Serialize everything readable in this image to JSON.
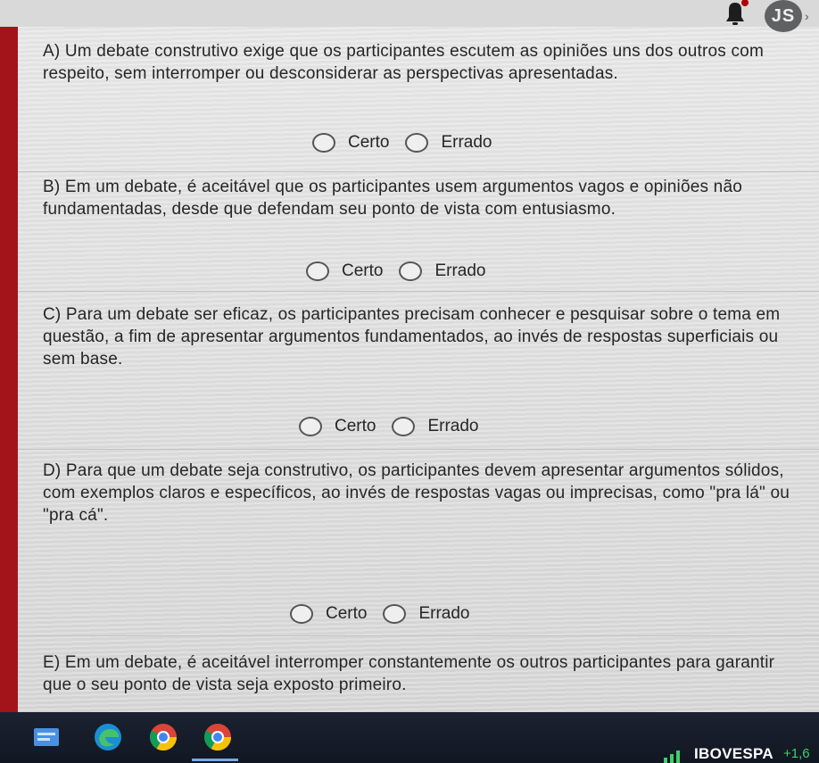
{
  "user": {
    "initials": "JS"
  },
  "questions": [
    {
      "text": "A) Um debate construtivo exige que os participantes escutem as opiniões uns dos outros com respeito, sem interromper ou desconsiderar as perspectivas apresentadas.",
      "options": [
        "Certo",
        "Errado"
      ]
    },
    {
      "text": "B)  Em um debate, é aceitável que os participantes usem argumentos vagos e opiniões não fundamentadas, desde que defendam seu ponto de vista com entusiasmo.",
      "options": [
        "Certo",
        "Errado"
      ]
    },
    {
      "text": "C) Para um debate ser eficaz, os participantes precisam conhecer e pesquisar sobre o tema em questão, a fim de apresentar argumentos fundamentados, ao invés de respostas superficiais ou sem base.",
      "options": [
        "Certo",
        "Errado"
      ]
    },
    {
      "text": "D) Para que um debate seja construtivo, os participantes devem apresentar argumentos sólidos, com exemplos claros e específicos, ao invés de respostas vagas ou imprecisas, como \"pra lá\" ou \"pra cá\".",
      "options": [
        "Certo",
        "Errado"
      ]
    },
    {
      "text": "E) Em um debate, é aceitável interromper constantemente os outros participantes para garantir que o seu ponto de vista seja exposto primeiro.",
      "options": []
    }
  ],
  "taskbar": {
    "apps": [
      "news-app",
      "edge-browser",
      "chrome-browser",
      "chrome-browser-active"
    ],
    "ticker_name": "IBOVESPA",
    "ticker_value": "+1,6"
  },
  "colors": {
    "accent_red": "#a2141a",
    "radio_border": "#555555",
    "taskbar": "#151b27",
    "ticker_up": "#3ecf6a"
  }
}
